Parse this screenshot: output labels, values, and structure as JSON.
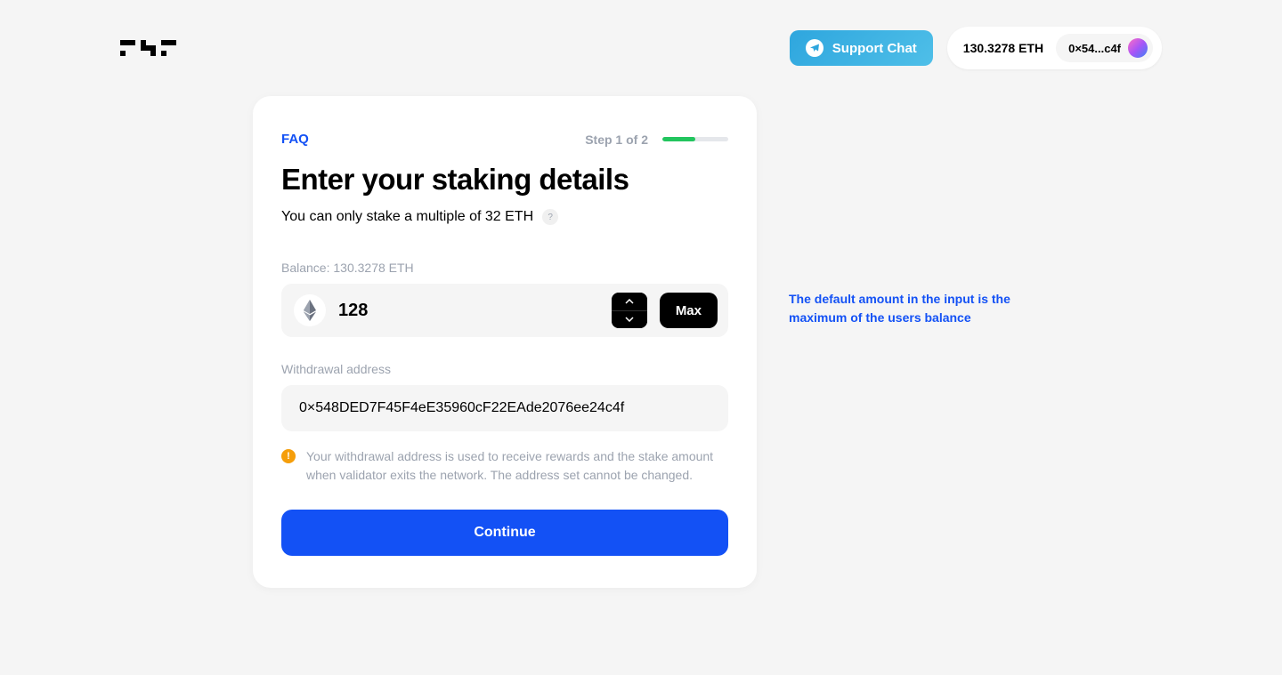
{
  "header": {
    "support_chat": "Support Chat",
    "balance": "130.3278 ETH",
    "address_short": "0×54...c4f"
  },
  "card": {
    "faq": "FAQ",
    "step_label": "Step 1 of 2",
    "title": "Enter your staking details",
    "subtitle": "You can only stake a multiple of 32 ETH",
    "balance_label": "Balance: 130.3278 ETH",
    "amount_value": "128",
    "max_label": "Max",
    "withdrawal_label": "Withdrawal address",
    "withdrawal_value": "0×548DED7F45F4eE35960cF22EAde2076ee24c4f",
    "info_text": "Your withdrawal address is used to receive rewards and the stake amount when validator exits the network. The address set cannot be changed.",
    "continue_label": "Continue"
  },
  "annotation": "The default amount in the input is the maximum of the users balance"
}
